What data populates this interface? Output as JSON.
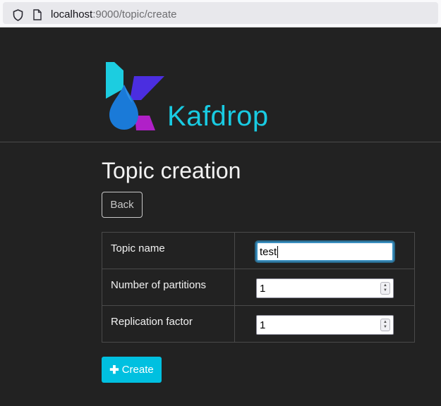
{
  "browser": {
    "url_host": "localhost",
    "url_path": ":9000/topic/create"
  },
  "header": {
    "brand": "Kafdrop"
  },
  "main": {
    "title": "Topic creation",
    "back_label": "Back",
    "fields": [
      {
        "label": "Topic name",
        "value": "test"
      },
      {
        "label": "Number of partitions",
        "value": "1"
      },
      {
        "label": "Replication factor",
        "value": "1"
      }
    ],
    "create_label": "Create",
    "create_icon": "plus-icon"
  },
  "colors": {
    "background": "#222222",
    "accent": "#19cbe2",
    "button": "#00c0e0"
  }
}
